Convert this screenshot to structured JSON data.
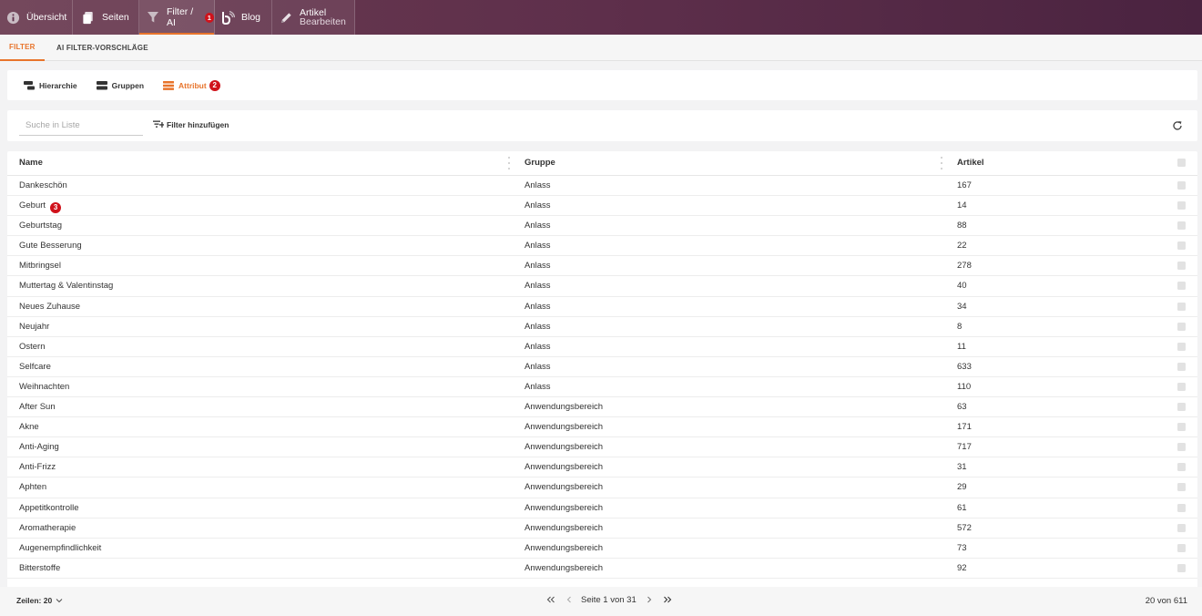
{
  "topnav": {
    "items": [
      {
        "label": "Übersicht",
        "icon": "info-icon"
      },
      {
        "label": "Seiten",
        "icon": "pages-icon"
      },
      {
        "label": "Filter / AI",
        "icon": "filter-icon",
        "badge": "1",
        "active": true
      },
      {
        "label": "Blog",
        "icon": "blog-icon"
      },
      {
        "label_line1": "Artikel",
        "label_line2": "Bearbeiten",
        "icon": "pencil-icon"
      }
    ]
  },
  "tabs": [
    {
      "label": "FILTER",
      "active": true
    },
    {
      "label": "AI FILTER-VORSCHLÄGE",
      "active": false
    }
  ],
  "subnav": {
    "items": [
      {
        "label": "Hierarchie",
        "icon": "hierarchy-icon"
      },
      {
        "label": "Gruppen",
        "icon": "groups-icon"
      },
      {
        "label": "Attribut",
        "icon": "attribute-icon",
        "badge": "2",
        "active": true
      }
    ]
  },
  "search": {
    "placeholder": "Suche in Liste"
  },
  "add_filter_label": "Filter hinzufügen",
  "table": {
    "columns": [
      "Name",
      "Gruppe",
      "Artikel"
    ],
    "rows": [
      {
        "name": "Dankeschön",
        "group": "Anlass",
        "count": "167"
      },
      {
        "name": "Geburt",
        "group": "Anlass",
        "count": "14",
        "badge": "3"
      },
      {
        "name": "Geburtstag",
        "group": "Anlass",
        "count": "88"
      },
      {
        "name": "Gute Besserung",
        "group": "Anlass",
        "count": "22"
      },
      {
        "name": "Mitbringsel",
        "group": "Anlass",
        "count": "278"
      },
      {
        "name": "Muttertag & Valentinstag",
        "group": "Anlass",
        "count": "40"
      },
      {
        "name": "Neues Zuhause",
        "group": "Anlass",
        "count": "34"
      },
      {
        "name": "Neujahr",
        "group": "Anlass",
        "count": "8"
      },
      {
        "name": "Ostern",
        "group": "Anlass",
        "count": "11"
      },
      {
        "name": "Selfcare",
        "group": "Anlass",
        "count": "633"
      },
      {
        "name": "Weihnachten",
        "group": "Anlass",
        "count": "110"
      },
      {
        "name": "After Sun",
        "group": "Anwendungsbereich",
        "count": "63"
      },
      {
        "name": "Akne",
        "group": "Anwendungsbereich",
        "count": "171"
      },
      {
        "name": "Anti-Aging",
        "group": "Anwendungsbereich",
        "count": "717"
      },
      {
        "name": "Anti-Frizz",
        "group": "Anwendungsbereich",
        "count": "31"
      },
      {
        "name": "Aphten",
        "group": "Anwendungsbereich",
        "count": "29"
      },
      {
        "name": "Appetitkontrolle",
        "group": "Anwendungsbereich",
        "count": "61"
      },
      {
        "name": "Aromatherapie",
        "group": "Anwendungsbereich",
        "count": "572"
      },
      {
        "name": "Augenempfindlichkeit",
        "group": "Anwendungsbereich",
        "count": "73"
      },
      {
        "name": "Bitterstoffe",
        "group": "Anwendungsbereich",
        "count": "92"
      }
    ]
  },
  "footer": {
    "rows_label": "Zeilen: 20",
    "page_label": "Seite 1 von 31",
    "total_label": "20 von 611"
  },
  "colors": {
    "accent": "#e8742b",
    "badge": "#d0121b",
    "topbar": "#5e2f4b"
  }
}
